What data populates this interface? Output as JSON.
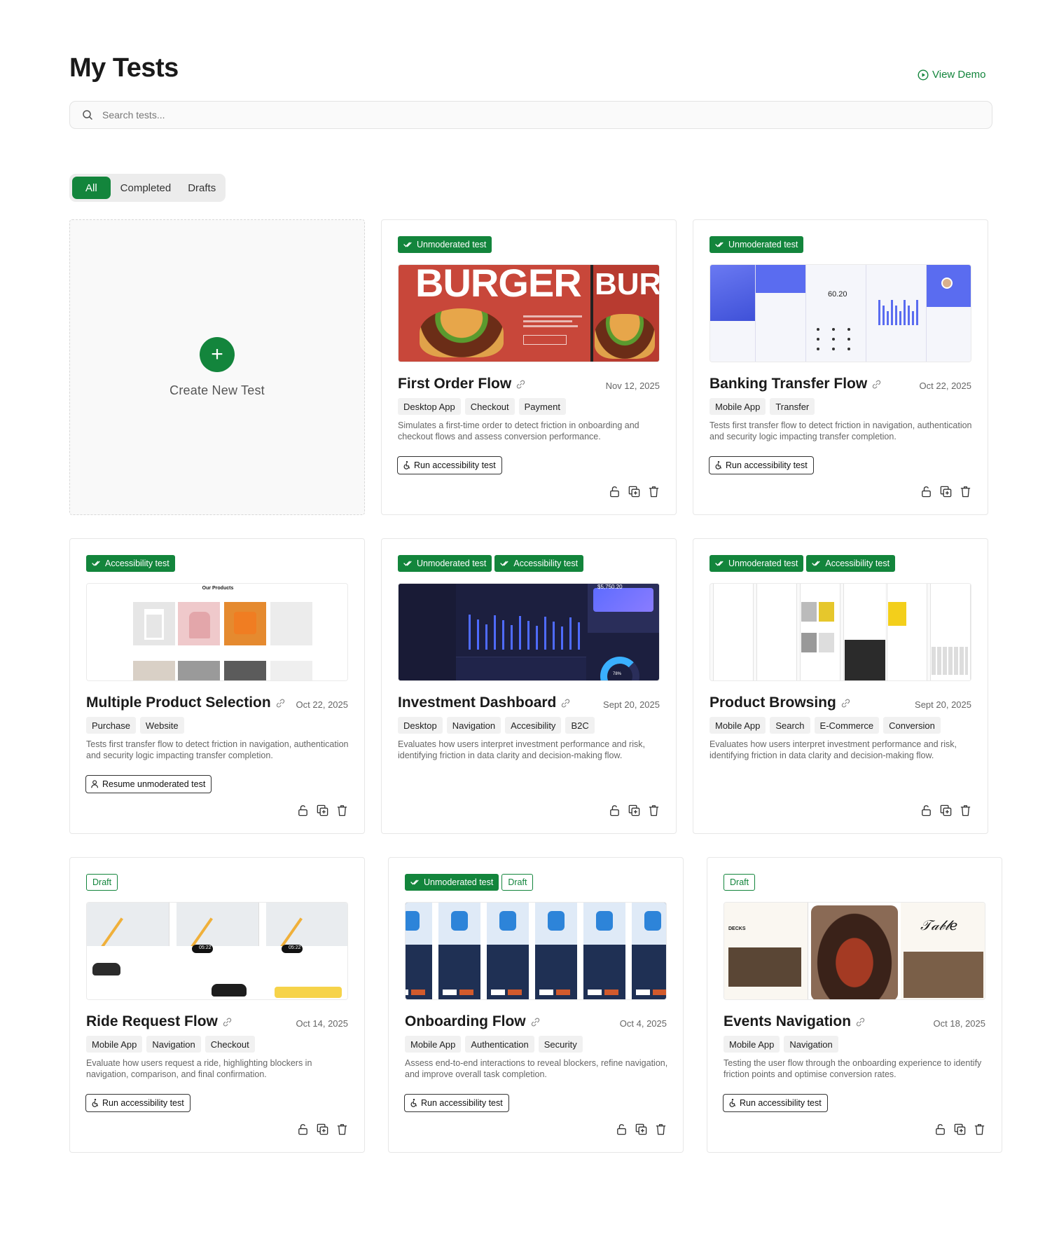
{
  "page": {
    "title": "My Tests",
    "view_demo": "View Demo"
  },
  "search": {
    "placeholder": "Search tests..."
  },
  "filters": [
    "All",
    "Completed",
    "Drafts"
  ],
  "create": {
    "label": "Create New Test"
  },
  "cards": [
    {
      "badges": [
        "Unmoderated test"
      ],
      "title": "First Order Flow",
      "date": "Nov 12, 2025",
      "tags": [
        "Desktop App",
        "Checkout",
        "Payment"
      ],
      "description": "Simulates a first-time order to detect friction in onboarding and checkout flows and assess conversion performance.",
      "action": "Run accessibility test",
      "thumb_text": [
        "BURGER",
        "BUR"
      ]
    },
    {
      "badges": [
        "Unmoderated test"
      ],
      "title": "Banking Transfer Flow",
      "date": "Oct 22, 2025",
      "tags": [
        "Mobile App",
        "Transfer"
      ],
      "description": "Tests first transfer flow to detect friction in navigation, authentication and security logic impacting transfer completion.",
      "action": "Run accessibility test",
      "thumb_text": [
        "60.20"
      ]
    },
    {
      "badges": [
        "Accessibility test"
      ],
      "title": "Multiple Product Selection",
      "date": "Oct 22, 2025",
      "tags": [
        "Purchase",
        "Website"
      ],
      "description": "Tests first transfer flow to detect friction in navigation, authentication and security logic impacting transfer completion.",
      "action": "Resume unmoderated test",
      "thumb_text": [
        "Our Products"
      ]
    },
    {
      "badges": [
        "Unmoderated test",
        "Accessibility test"
      ],
      "title": "Investment Dashboard",
      "date": "Sept 20, 2025",
      "tags": [
        "Desktop",
        "Navigation",
        "Accesibility",
        "B2C"
      ],
      "description": "Evaluates how users interpret investment performance and risk, identifying friction in data clarity and decision-making flow.",
      "action": "",
      "thumb_text": [
        "$5,750.20",
        "78%"
      ]
    },
    {
      "badges": [
        "Unmoderated test",
        "Accessibility test"
      ],
      "title": "Product Browsing",
      "date": "Sept 20, 2025",
      "tags": [
        "Mobile App",
        "Search",
        "E-Commerce",
        "Conversion"
      ],
      "description": "Evaluates how users interpret investment performance and risk, identifying friction in data clarity and decision-making flow.",
      "action": "",
      "thumb_text": []
    },
    {
      "badges": [
        "Draft"
      ],
      "title": "Ride Request Flow",
      "date": "Oct 14, 2025",
      "tags": [
        "Mobile App",
        "Navigation",
        "Checkout"
      ],
      "description": "Evaluate how users request a ride, highlighting blockers in navigation, comparison, and final confirmation.",
      "action": "Run accessibility test",
      "thumb_text": [
        "05:22",
        "05:22"
      ]
    },
    {
      "badges": [
        "Unmoderated test",
        "Draft"
      ],
      "title": "Onboarding Flow",
      "date": "Oct 4, 2025",
      "tags": [
        "Mobile App",
        "Authentication",
        "Security"
      ],
      "description": "Assess end-to-end interactions to reveal blockers, refine navigation, and improve overall task completion.",
      "action": "Run accessibility test",
      "thumb_text": []
    },
    {
      "badges": [
        "Draft"
      ],
      "title": "Events Navigation",
      "date": "Oct 18, 2025",
      "tags": [
        "Mobile App",
        "Navigation"
      ],
      "description": "Testing the user flow through the onboarding experience to identify friction points and optimise conversion rates.",
      "action": "Run accessibility test",
      "thumb_text": [
        "DECKS"
      ]
    }
  ],
  "colors": {
    "accent": "#13853c",
    "tag_bg": "#f1f1f1",
    "dark_thumb": "#1c1f3f",
    "burger_red": "#c8473a",
    "bank_blue": "#5a6cf0"
  },
  "icons": {
    "search": "search-icon",
    "play": "play-circle-icon",
    "plus": "plus-icon",
    "check": "double-check-icon",
    "link": "link-icon",
    "accessibility": "accessibility-icon",
    "user": "user-icon",
    "unlock": "unlock-icon",
    "duplicate": "duplicate-icon",
    "trash": "trash-icon"
  }
}
